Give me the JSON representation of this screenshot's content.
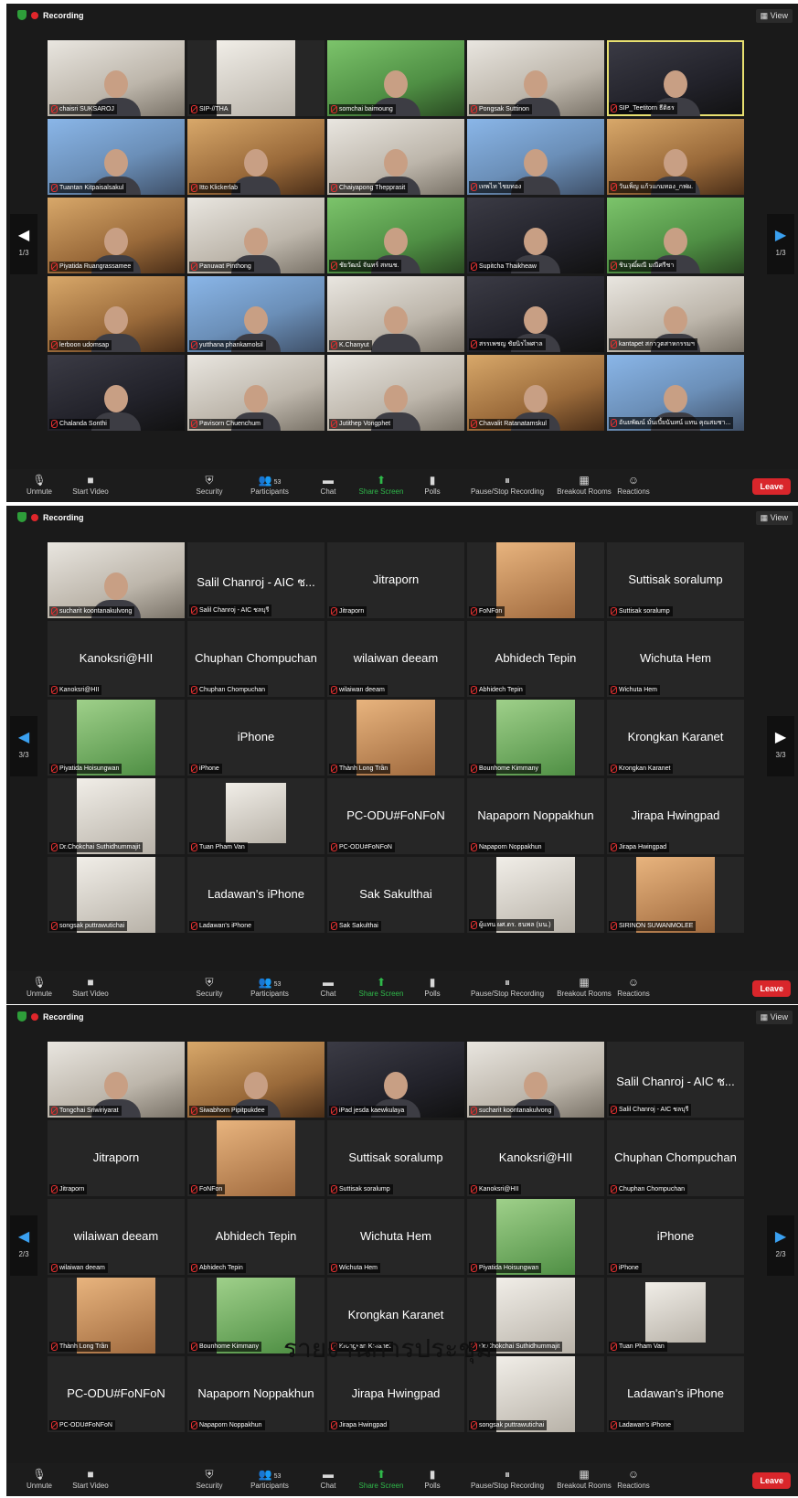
{
  "recording_label": "Recording",
  "view_label": "View",
  "leave_label": "Leave",
  "toolbar": {
    "unmute": "Unmute",
    "start_video": "Start Video",
    "security": "Security",
    "participants": "Participants",
    "participants_count": "53",
    "chat": "Chat",
    "share_screen": "Share Screen",
    "polls": "Polls",
    "pause_stop_recording": "Pause/Stop Recording",
    "breakout_rooms": "Breakout Rooms",
    "reactions": "Reactions"
  },
  "caption": "รายงานการประชุม",
  "panels": [
    {
      "page_left": "1/3",
      "page_right": "1/3",
      "tiles": [
        {
          "name": "chaisri SUKSAROJ",
          "kind": "video",
          "tone": "w"
        },
        {
          "name": "SIP-//THA",
          "kind": "logo",
          "tone": "w"
        },
        {
          "name": "somchai baimoung",
          "kind": "video",
          "tone": "g"
        },
        {
          "name": "Pongsak Suttinon",
          "kind": "video",
          "tone": "w"
        },
        {
          "name": "SIP_Teetitorn ธีติธร",
          "kind": "video",
          "tone": "d",
          "highlight": true
        },
        {
          "name": "Tuantan Kitpaisalsakul",
          "kind": "video",
          "tone": "b"
        },
        {
          "name": "Itto Klickerlab",
          "kind": "video",
          "tone": "o"
        },
        {
          "name": "Chaiyapong Thepprasit",
          "kind": "video",
          "tone": "w"
        },
        {
          "name": "เทพไท ไชยทอง",
          "kind": "video",
          "tone": "b"
        },
        {
          "name": "วันเพ็ญ แก้วแกมทอง_กฟผ.",
          "kind": "video",
          "tone": "o"
        },
        {
          "name": "Piyatida Ruangrassamee",
          "kind": "video",
          "tone": "o"
        },
        {
          "name": "Panuwat Pinthong",
          "kind": "video",
          "tone": "w"
        },
        {
          "name": "ชัยวัฒน์ จันทร์ สทนช.",
          "kind": "video",
          "tone": "g"
        },
        {
          "name": "Supitcha Thaikheaw",
          "kind": "video",
          "tone": "d"
        },
        {
          "name": "ชินวุฒิ์ผณี มณีศรีชา",
          "kind": "video",
          "tone": "g"
        },
        {
          "name": "lerboon udomsap",
          "kind": "video",
          "tone": "o"
        },
        {
          "name": "yutthana phankamolsil",
          "kind": "video",
          "tone": "b"
        },
        {
          "name": "K.Chanyut",
          "kind": "video",
          "tone": "w"
        },
        {
          "name": "สรรเพชญ ชัยนิรไพศาล",
          "kind": "video",
          "tone": "d"
        },
        {
          "name": "kantapet สกาวูตสาหกรรมฯ",
          "kind": "video",
          "tone": "w"
        },
        {
          "name": "Chalanda Sonthi",
          "kind": "video",
          "tone": "d"
        },
        {
          "name": "Pavisorn Chuenchum",
          "kind": "video",
          "tone": "w"
        },
        {
          "name": "Jutithep Vongphet",
          "kind": "video",
          "tone": "w"
        },
        {
          "name": "Chavalit Ratanatamskul",
          "kind": "video",
          "tone": "o"
        },
        {
          "name": "อันยพัฒน์ มั่นเบี้ยนันทน์ แทน คุณสมชา...",
          "kind": "video",
          "tone": "b"
        }
      ]
    },
    {
      "page_left": "3/3",
      "page_right": "3/3",
      "tiles": [
        {
          "name": "sucharit koontanakulvong",
          "kind": "video",
          "tone": "w"
        },
        {
          "name": "Salil Chanroj - AIC ชลบุรี",
          "kind": "text",
          "display": "Salil Chanroj - AIC ช..."
        },
        {
          "name": "Jitraporn",
          "kind": "text",
          "display": "Jitraporn"
        },
        {
          "name": "FoNFon",
          "kind": "photo",
          "tone": "o"
        },
        {
          "name": "Suttisak soralump",
          "kind": "text",
          "display": "Suttisak soralump"
        },
        {
          "name": "Kanoksri@HII",
          "kind": "text",
          "display": "Kanoksri@HII"
        },
        {
          "name": "Chuphan Chompuchan",
          "kind": "text",
          "display": "Chuphan Chompuchan"
        },
        {
          "name": "wilaiwan deeam",
          "kind": "text",
          "display": "wilaiwan deeam"
        },
        {
          "name": "Abhidech Tepin",
          "kind": "text",
          "display": "Abhidech Tepin"
        },
        {
          "name": "Wichuta Hem",
          "kind": "text",
          "display": "Wichuta Hem"
        },
        {
          "name": "Piyatida Hoisungwan",
          "kind": "photo",
          "tone": "g"
        },
        {
          "name": "iPhone",
          "kind": "text",
          "display": "iPhone"
        },
        {
          "name": "Thành Long Trần",
          "kind": "photo",
          "tone": "o"
        },
        {
          "name": "Bounhome Kimmany",
          "kind": "photo",
          "tone": "g"
        },
        {
          "name": "Krongkan Karanet",
          "kind": "text",
          "display": "Krongkan Karanet"
        },
        {
          "name": "Dr.Chokchai Suthidhummajit",
          "kind": "photo",
          "tone": "w"
        },
        {
          "name": "Tuan Pham Van",
          "kind": "photo",
          "tone": "w",
          "small": true
        },
        {
          "name": "PC-ODU#FoNFoN",
          "kind": "text",
          "display": "PC-ODU#FoNFoN"
        },
        {
          "name": "Napaporn Noppakhun",
          "kind": "text",
          "display": "Napaporn Noppakhun"
        },
        {
          "name": "Jirapa Hwingpad",
          "kind": "text",
          "display": "Jirapa Hwingpad"
        },
        {
          "name": "songsak puttrawutichai",
          "kind": "photo",
          "tone": "w"
        },
        {
          "name": "Ladawan's iPhone",
          "kind": "text",
          "display": "Ladawan's iPhone"
        },
        {
          "name": "Sak Sakulthai",
          "kind": "text",
          "display": "Sak Sakulthai"
        },
        {
          "name": "ผู้แทน ผศ.ดร. ธนพล (มน.)",
          "kind": "photo",
          "tone": "w"
        },
        {
          "name": "SIRINON SUWANMOLEE",
          "kind": "photo",
          "tone": "o"
        }
      ]
    },
    {
      "page_left": "2/3",
      "page_right": "2/3",
      "tiles": [
        {
          "name": "Tongchai Sriwiriyarat",
          "kind": "video",
          "tone": "w"
        },
        {
          "name": "Siwabhorn Pipitpukdee",
          "kind": "video",
          "tone": "o"
        },
        {
          "name": "iPad jesda kaewkulaya",
          "kind": "video",
          "tone": "d"
        },
        {
          "name": "sucharit koontanakulvong",
          "kind": "video",
          "tone": "w"
        },
        {
          "name": "Salil Chanroj - AIC ชลบุรี",
          "kind": "text",
          "display": "Salil Chanroj - AIC ช..."
        },
        {
          "name": "Jitraporn",
          "kind": "text",
          "display": "Jitraporn"
        },
        {
          "name": "FoNFon",
          "kind": "photo",
          "tone": "o"
        },
        {
          "name": "Suttisak soralump",
          "kind": "text",
          "display": "Suttisak soralump"
        },
        {
          "name": "Kanoksri@HII",
          "kind": "text",
          "display": "Kanoksri@HII"
        },
        {
          "name": "Chuphan Chompuchan",
          "kind": "text",
          "display": "Chuphan Chompuchan"
        },
        {
          "name": "wilaiwan deeam",
          "kind": "text",
          "display": "wilaiwan deeam"
        },
        {
          "name": "Abhidech Tepin",
          "kind": "text",
          "display": "Abhidech Tepin"
        },
        {
          "name": "Wichuta Hem",
          "kind": "text",
          "display": "Wichuta Hem"
        },
        {
          "name": "Piyatida Hoisungwan",
          "kind": "photo",
          "tone": "g"
        },
        {
          "name": "iPhone",
          "kind": "text",
          "display": "iPhone"
        },
        {
          "name": "Thành Long Trần",
          "kind": "photo",
          "tone": "o"
        },
        {
          "name": "Bounhome Kimmany",
          "kind": "photo",
          "tone": "g"
        },
        {
          "name": "Krongkan Karanet",
          "kind": "text",
          "display": "Krongkan Karanet"
        },
        {
          "name": "Dr.Chokchai Suthidhummajit",
          "kind": "photo",
          "tone": "w"
        },
        {
          "name": "Tuan Pham Van",
          "kind": "photo",
          "tone": "w",
          "small": true
        },
        {
          "name": "PC-ODU#FoNFoN",
          "kind": "text",
          "display": "PC-ODU#FoNFoN"
        },
        {
          "name": "Napaporn Noppakhun",
          "kind": "text",
          "display": "Napaporn Noppakhun"
        },
        {
          "name": "Jirapa Hwingpad",
          "kind": "text",
          "display": "Jirapa Hwingpad"
        },
        {
          "name": "songsak puttrawutichai",
          "kind": "photo",
          "tone": "w"
        },
        {
          "name": "Ladawan's iPhone",
          "kind": "text",
          "display": "Ladawan's iPhone"
        }
      ]
    }
  ]
}
